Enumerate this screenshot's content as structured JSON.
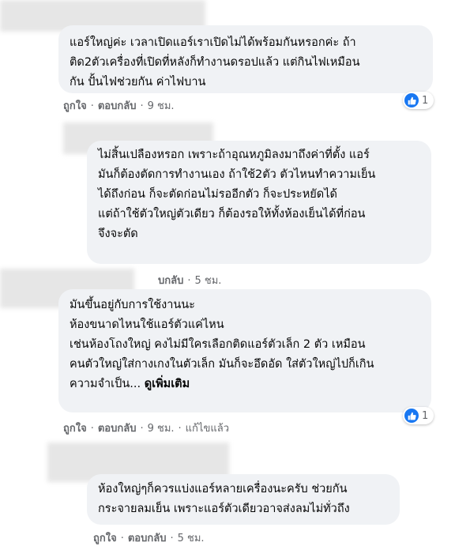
{
  "comments": [
    {
      "lines": [
        "แอร์ใหญ่ค่ะ เวลาเปิดแอร์เราเปิดไม่ได้พร้อมกันหรอกค่ะ ถ้า",
        "ติด2ตัวเครื่องที่เปิดที่หลังก็ทำงานดรอปแล้ว แต่กินไฟเหมือน",
        "กัน ปั้นไฟช่วยกัน ค่าไฟบาน"
      ],
      "like": "ถูกใจ",
      "reply": "ตอบกลับ",
      "time": "9 ชม.",
      "reaction_count": "1"
    },
    {
      "lines": [
        "ไม่สิ้นเปลืองหรอก เพราะถ้าอุณหภูมิลงมาถึงค่าที่ตั้ง แอร์",
        "มันก็ต้องตัดการทำงานเอง ถ้าใช้2ตัว ตัวไหนทำความเย็น",
        "ได้ถึงก่อน ก็จะตัดก่อนไม่รออีกตัว ก็จะประหยัดได้",
        "แต่ถ้าใช้ตัวใหญ่ตัวเดียว ก็ต้องรอให้ทั้งห้องเย็นได้ที่ก่อน",
        "จึงจะตัด"
      ],
      "reply_partial": "บกลับ",
      "time": "5 ชม."
    },
    {
      "lines": [
        "มันขึ้นอยู่กับการใช้งานนะ",
        "ห้องขนาดไหนใช้แอร์ตัวแค่ไหน",
        "เช่นห้องโถงใหญ่ คงไม่มีใครเลือกติดแอร์ตัวเล็ก 2 ตัว เหมือน",
        "คนตัวใหญ่ใส่กางเกงในตัวเล็ก มันก็จะอึดอัด ใส่ตัวใหญ่ไปก็เกิน",
        "ความจำเป็น..."
      ],
      "see_more": "ดูเพิ่มเติม",
      "like": "ถูกใจ",
      "reply": "ตอบกลับ",
      "time": "9 ชม.",
      "edited": "แก้ไขแล้ว",
      "reaction_count": "1"
    },
    {
      "lines": [
        "ห้องใหญ่ๆก็ควรแบ่งแอร์หลายเครื่องนะครับ ช่วยกัน",
        "กระจายลมเย็น เพราะแอร์ตัวเดียวอาจส่งลมไม่ทั่วถึง"
      ],
      "like": "ถูกใจ",
      "reply": "ตอบกลับ",
      "time": "5 ชม."
    }
  ],
  "colors": {
    "bubble": "#f0f2f5",
    "meta": "#65676b",
    "like_blue": "#1877f2"
  }
}
